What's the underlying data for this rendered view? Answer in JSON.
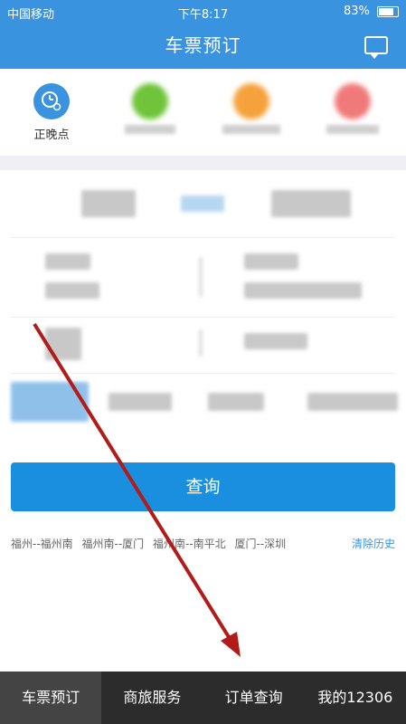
{
  "status": {
    "carrier": "中国移动",
    "time": "下午8:17",
    "battery": "83%"
  },
  "header": {
    "title": "车票预订"
  },
  "services": [
    {
      "label": "正晚点"
    }
  ],
  "search": {
    "button_label": "查询"
  },
  "history": {
    "items": [
      "福州--福州南",
      "福州南--厦门",
      "福州南--南平北",
      "厦门--深圳"
    ],
    "clear_label": "清除历史"
  },
  "tabbar": {
    "tabs": [
      {
        "label": "车票预订"
      },
      {
        "label": "商旅服务"
      },
      {
        "label": "订单查询"
      },
      {
        "label": "我的12306"
      }
    ]
  }
}
